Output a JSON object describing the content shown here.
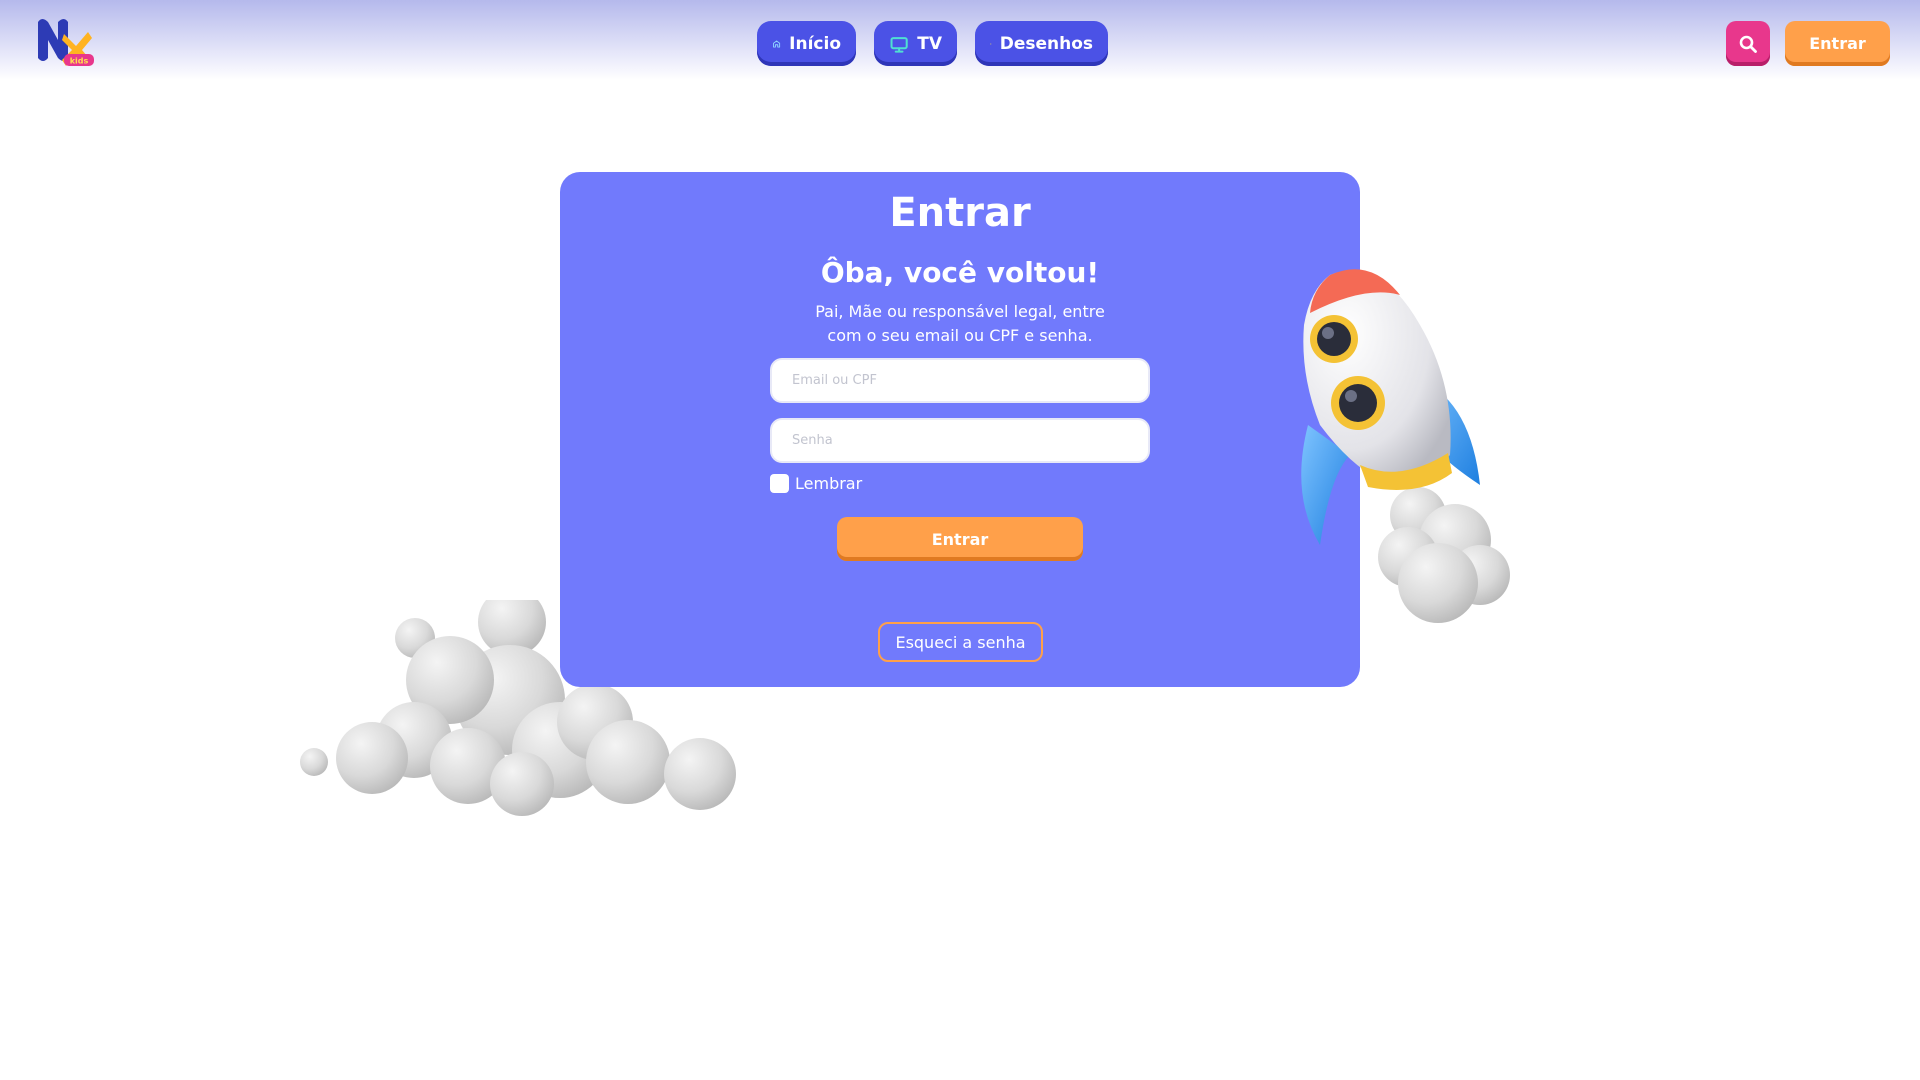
{
  "header": {
    "logo_name": "nx-kids-logo",
    "nav": [
      {
        "label": "Início",
        "icon": "home-icon"
      },
      {
        "label": "TV",
        "icon": "tv-icon"
      },
      {
        "label": "Desenhos",
        "icon": "sparkle-icon"
      }
    ],
    "search_icon": "search-icon",
    "login_label": "Entrar"
  },
  "login": {
    "title": "Entrar",
    "subtitle": "Ôba, você voltou!",
    "description": "Pai, Mãe ou responsável legal, entre com o seu email ou CPF e senha.",
    "email_placeholder": "Email ou CPF",
    "password_placeholder": "Senha",
    "remember_label": "Lembrar",
    "submit_label": "Entrar",
    "forgot_label": "Esqueci a senha"
  },
  "colors": {
    "card": "#717afc",
    "nav": "#4b52e6",
    "accent_orange": "#ffa04a",
    "accent_pink": "#e8378c"
  }
}
